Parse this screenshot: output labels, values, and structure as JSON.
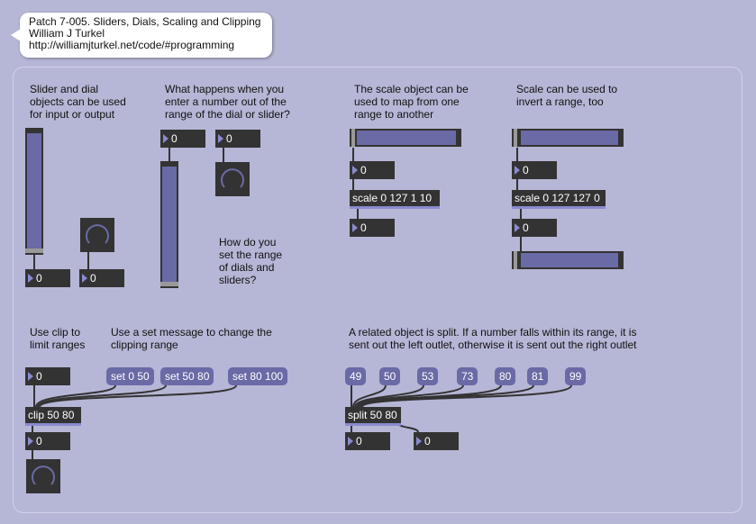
{
  "header": {
    "title": "Patch 7-005. Sliders, Dials, Scaling and Clipping",
    "author": "William J Turkel",
    "url": "http://williamjturkel.net/code/#programming"
  },
  "comments": {
    "slider_dial": "Slider and dial\nobjects can be used\nfor input or output",
    "out_of_range": "What happens when you\nenter a number out of the\nrange of the dial or slider?",
    "set_range": "How do you\nset the range\nof dials and\nsliders?",
    "scale_map": "The scale object can be\nused to map from one\nrange to another",
    "scale_invert": "Scale can be used to\ninvert a range, too",
    "clip_limit": "Use clip to\nlimit ranges",
    "set_message": "Use a set message to change the\nclipping range",
    "split_info": "A related object is split. If a number falls within its range, it is\nsent out the left outlet, otherwise it is sent out the right outlet"
  },
  "numbers": {
    "slider_out": "0",
    "dial_out": "0",
    "range_in_slider": "0",
    "range_in_dial": "0",
    "scale1_in": "0",
    "scale1_out": "0",
    "scale2_in": "0",
    "scale2_out": "0",
    "clip_in": "0",
    "clip_out": "0",
    "split_left": "0",
    "split_right": "0"
  },
  "objects": {
    "scale1": "scale 0 127 1 10",
    "scale2": "scale 0 127 127 0",
    "clip": "clip 50 80",
    "split": "split 50 80"
  },
  "messages": {
    "set1": "set 0 50",
    "set2": "set 50 80",
    "set3": "set 80 100",
    "split_values": [
      "49",
      "50",
      "53",
      "73",
      "80",
      "81",
      "99"
    ]
  },
  "levels": {
    "slider1": 0.0,
    "slider2": 0.0,
    "hslider1": 0.0,
    "hslider2": 1.0
  },
  "colors": {
    "background": "#b6b6d6",
    "box": "#333333",
    "accent": "#6a6aa6",
    "inlet": "#8a8ad0"
  }
}
